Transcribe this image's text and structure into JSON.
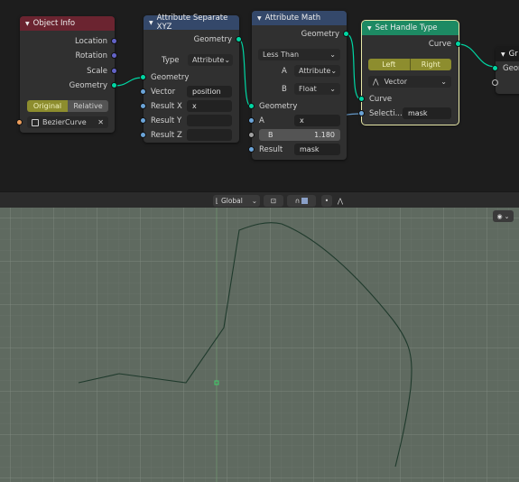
{
  "nodes": {
    "object_info": {
      "title": "Object Info",
      "color": "#6b2430",
      "outputs": [
        "Location",
        "Rotation",
        "Scale",
        "Geometry"
      ],
      "toggle": {
        "options": [
          "Original",
          "Relative"
        ],
        "selected": "Original"
      },
      "object_value": "BezierCurve"
    },
    "attribute_separate": {
      "title": "Attribute Separate XYZ",
      "color": "#34486a",
      "output": "Geometry",
      "type_label": "Type",
      "type_value": "Attribute",
      "inputs": [
        {
          "label": "Geometry",
          "value": ""
        },
        {
          "label": "Vector",
          "value": "position"
        },
        {
          "label": "Result X",
          "value": "x"
        },
        {
          "label": "Result Y",
          "value": ""
        },
        {
          "label": "Result Z",
          "value": ""
        }
      ]
    },
    "attribute_math": {
      "title": "Attribute Math",
      "color": "#34486a",
      "output": "Geometry",
      "operation": "Less Than",
      "a_label": "A",
      "a_type": "Attribute",
      "b_label": "B",
      "b_type": "Float",
      "geometry_label": "Geometry",
      "a_value_label": "A",
      "a_value": "x",
      "b_value_label": "B",
      "b_value": "1.180",
      "result_label": "Result",
      "result_value": "mask"
    },
    "set_handle_type": {
      "title": "Set Handle Type",
      "color": "#1d8a63",
      "output": "Curve",
      "sides": [
        "Left",
        "Right"
      ],
      "handle_type": "Vector",
      "curve_label": "Curve",
      "selection_label": "Selecti...",
      "selection_value": "mask"
    },
    "group_output": {
      "title": "Gr",
      "output_label": "Geom"
    }
  },
  "viewport_header": {
    "orientation": "Global"
  },
  "colors": {
    "editor_bg": "#1d1d1d",
    "viewport_bg": "#5f6a60",
    "curve": "#1f3a2c",
    "origin": "#3fd06a"
  }
}
